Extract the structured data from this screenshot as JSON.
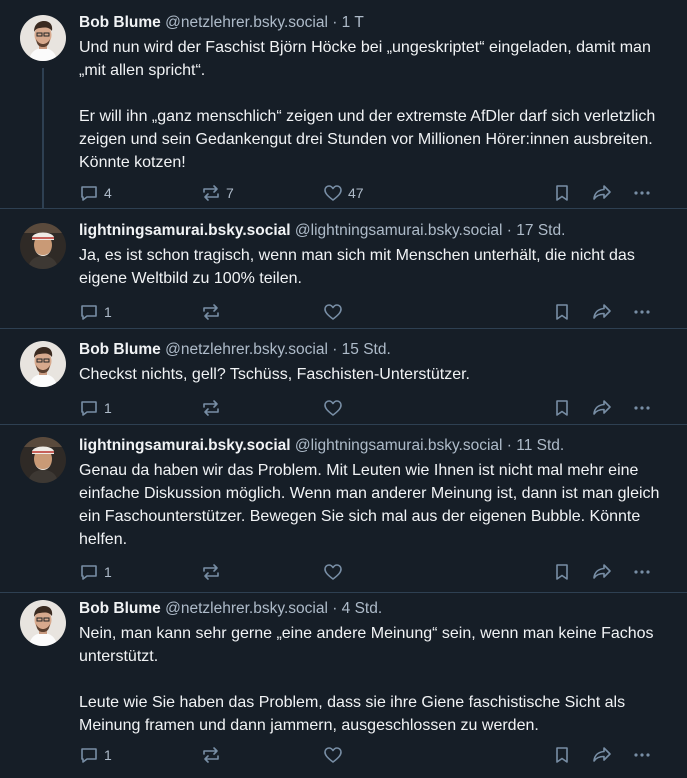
{
  "posts": [
    {
      "author": "Bob Blume",
      "handle": "@netzlehrer.bsky.social",
      "time": "1 T",
      "paragraphs": [
        "Und nun wird der Faschist Björn Höcke bei „ungeskriptet“ eingeladen, damit man „mit allen spricht“.",
        "Er will ihn „ganz menschlich“ zeigen und  der extremste AfDler darf sich verletzlich zeigen und sein Gedankengut drei Stunden vor Millionen Hörer:innen ausbreiten. Könnte kotzen!"
      ],
      "replies": "4",
      "reposts": "7",
      "likes": "47",
      "avatar_type": "bob"
    },
    {
      "author": "lightningsamurai.bsky.social",
      "handle": "@lightningsamurai.bsky.social",
      "time": "17 Std.",
      "paragraphs": [
        "Ja, es ist schon tragisch, wenn man sich mit Menschen unterhält, die nicht das eigene Weltbild zu 100% teilen."
      ],
      "replies": "1",
      "reposts": "",
      "likes": "",
      "avatar_type": "samurai"
    },
    {
      "author": "Bob Blume",
      "handle": "@netzlehrer.bsky.social",
      "time": "15 Std.",
      "paragraphs": [
        "Checkst nichts, gell? Tschüss, Faschisten-Unterstützer."
      ],
      "replies": "1",
      "reposts": "",
      "likes": "",
      "avatar_type": "bob"
    },
    {
      "author": "lightningsamurai.bsky.social",
      "handle": "@lightningsamurai.bsky.social",
      "time": "11 Std.",
      "paragraphs": [
        "Genau da haben wir das Problem. Mit Leuten wie Ihnen ist nicht mal mehr eine einfache Diskussion möglich. Wenn man anderer Meinung ist, dann ist man gleich ein Faschounterstützer. Bewegen Sie sich mal aus der eigenen Bubble. Könnte helfen."
      ],
      "replies": "1",
      "reposts": "",
      "likes": "",
      "avatar_type": "samurai"
    },
    {
      "author": "Bob Blume",
      "handle": "@netzlehrer.bsky.social",
      "time": "4 Std.",
      "paragraphs": [
        "Nein, man kann sehr gerne „eine andere Meinung“ sein, wenn man keine Fachos unterstützt.",
        "Leute wie Sie haben das Problem, dass sie ihre Giene faschistische Sicht als Meinung framen und dann jammern, ausgeschlossen zu werden."
      ],
      "replies": "1",
      "reposts": "",
      "likes": "",
      "avatar_type": "bob"
    }
  ],
  "ui": {
    "dot": " · ",
    "icons": {
      "reply": "reply-icon",
      "repost": "repost-icon",
      "like": "heart-icon",
      "save": "bookmark-icon",
      "share": "share-icon",
      "more": "more-icon"
    }
  },
  "colors": {
    "background": "#161e27",
    "text": "#f1f3f5",
    "muted": "#aebbc9",
    "icon": "#788ea5",
    "divider": "#2e4052"
  }
}
